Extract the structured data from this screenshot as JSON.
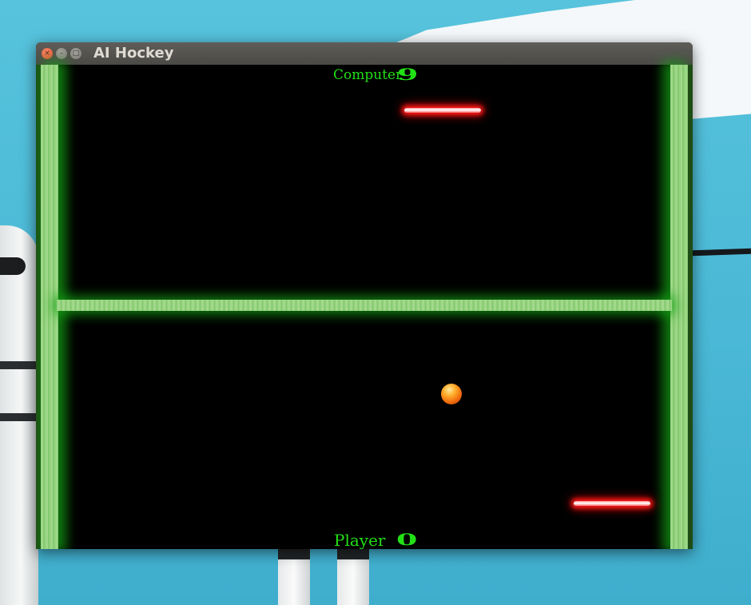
{
  "window": {
    "title": "AI Hockey",
    "close_glyph": "×",
    "minimize_glyph": "–",
    "maximize_glyph": "□"
  },
  "scores": {
    "computer": {
      "label": "Computer",
      "value": "9"
    },
    "player": {
      "label": "Player",
      "value": "0"
    }
  },
  "icons": {
    "close": "close-icon",
    "minimize": "minimize-icon",
    "maximize": "maximize-icon"
  },
  "colors": {
    "field": "#000000",
    "wall": "#9fd887",
    "wall_glow": "#14a014",
    "score_text": "#22e016",
    "paddle_glow": "#ff1a1a",
    "puck": "#f06a0c",
    "titlebar": "#4b4a46"
  }
}
